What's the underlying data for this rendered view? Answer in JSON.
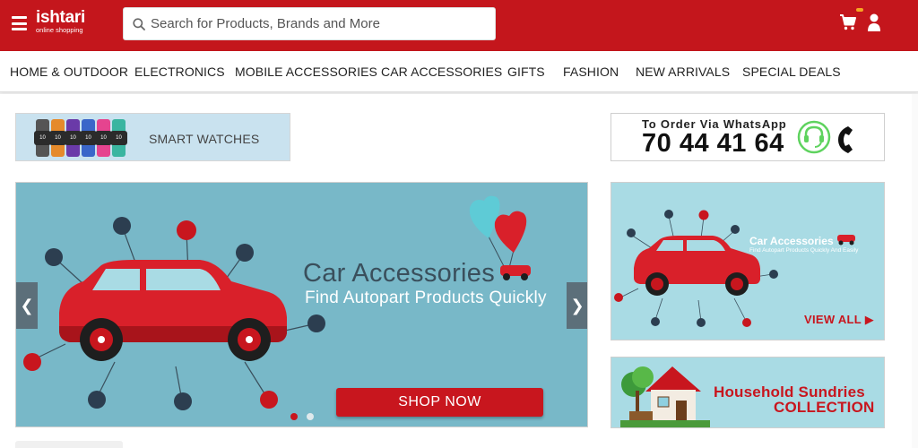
{
  "header": {
    "logo_name": "ishtari",
    "logo_tagline": "online shopping",
    "search_placeholder": "Search for Products, Brands and More",
    "icons": [
      "menu-icon",
      "search-icon",
      "cart-icon",
      "user-icon"
    ]
  },
  "nav": {
    "items": [
      {
        "label": "HOME & OUTDOOR"
      },
      {
        "label": "ELECTRONICS"
      },
      {
        "label": "MOBILE ACCESSORIES"
      },
      {
        "label": "CAR ACCESSORIES"
      },
      {
        "label": "GIFTS"
      },
      {
        "label": "FASHION"
      },
      {
        "label": "NEW ARRIVALS"
      },
      {
        "label": "SPECIAL DEALS"
      }
    ]
  },
  "smart_watches": {
    "label": "SMART WATCHES",
    "watch_numbers": [
      "10",
      "10",
      "10",
      "10",
      "10",
      "10"
    ]
  },
  "whatsapp": {
    "title": "To Order Via WhatsApp",
    "number": "70 44 41 64"
  },
  "slider": {
    "headline": "Car Accessories",
    "subheadline": "Find Autopart Products Quickly",
    "button": "SHOP NOW",
    "prev": "❮",
    "next": "❯",
    "slide_count": 2,
    "active_slide": 1
  },
  "car_card": {
    "title": "Car Accessories",
    "subtitle": "Find Autopart Products Quickly And Easily",
    "cta": "VIEW ALL ▶"
  },
  "house_card": {
    "line1": "Household Sundries",
    "line2": "COLLECTION"
  },
  "colors": {
    "brand_red": "#c4161c",
    "banner_teal": "#78b8c8",
    "card_teal": "#a9dbe4",
    "whatsapp_green": "#5fd35f"
  }
}
